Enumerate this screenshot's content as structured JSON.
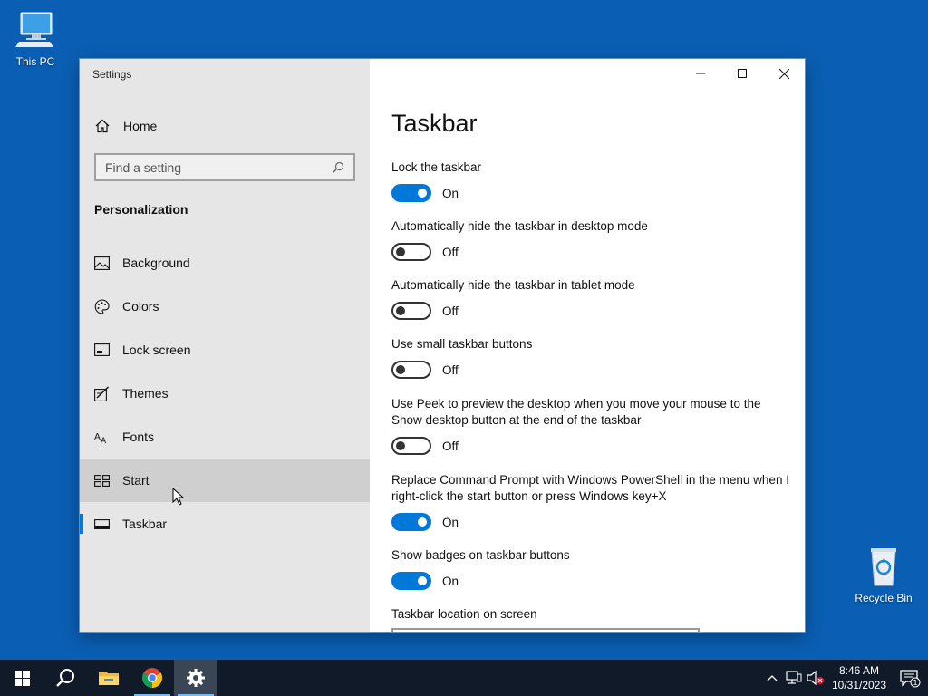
{
  "desktop": {
    "icons": [
      {
        "label": "This PC"
      },
      {
        "label": "Recycle Bin"
      }
    ]
  },
  "window": {
    "title": "Settings",
    "nav": {
      "home_label": "Home",
      "search_placeholder": "Find a setting",
      "section": "Personalization",
      "items": [
        {
          "label": "Background",
          "icon": "picture-icon"
        },
        {
          "label": "Colors",
          "icon": "palette-icon"
        },
        {
          "label": "Lock screen",
          "icon": "lock-screen-icon"
        },
        {
          "label": "Themes",
          "icon": "themes-icon"
        },
        {
          "label": "Fonts",
          "icon": "fonts-icon"
        },
        {
          "label": "Start",
          "icon": "start-icon",
          "hover": true
        },
        {
          "label": "Taskbar",
          "icon": "taskbar-icon",
          "selected": true
        }
      ]
    },
    "content": {
      "title": "Taskbar",
      "settings": [
        {
          "label": "Lock the taskbar",
          "state": "On"
        },
        {
          "label": "Automatically hide the taskbar in desktop mode",
          "state": "Off"
        },
        {
          "label": "Automatically hide the taskbar in tablet mode",
          "state": "Off"
        },
        {
          "label": "Use small taskbar buttons",
          "state": "Off"
        },
        {
          "label": "Use Peek to preview the desktop when you move your mouse to the Show desktop button at the end of the taskbar",
          "state": "Off"
        },
        {
          "label": "Replace Command Prompt with Windows PowerShell in the menu when I right-click the start button or press Windows key+X",
          "state": "On"
        },
        {
          "label": "Show badges on taskbar buttons",
          "state": "On"
        }
      ],
      "location_label": "Taskbar location on screen"
    }
  },
  "taskbar": {
    "clock_time": "8:46 AM",
    "clock_date": "10/31/2023",
    "notification_count": "1"
  },
  "colors": {
    "accent": "#0078d7",
    "desktop": "#0a5fb4",
    "taskbar": "#101a28"
  }
}
